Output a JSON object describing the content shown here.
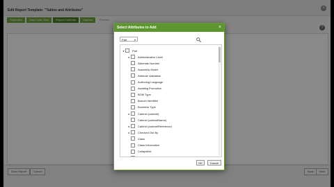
{
  "app": {
    "title": "Edit Report Template: \"Tables and Attributes\"",
    "steps": [
      "Properties",
      "Data Data View",
      "Report Contents",
      "Options",
      "Preview"
    ],
    "footer": {
      "save_report": "Save Report",
      "cancel": "Cancel",
      "back": "Back",
      "next": "Next"
    }
  },
  "modal": {
    "title": "Select Attributes to Add",
    "close": "×",
    "filter_value": "Part",
    "ok": "OK",
    "cancel": "Cancel",
    "tree": [
      {
        "label": "Part",
        "toggle": "▾"
      },
      {
        "label": "Administrative Level",
        "toggle": "▸"
      },
      {
        "label": "Alternate Number",
        "toggle": ""
      },
      {
        "label": "Assembly Model",
        "toggle": ""
      },
      {
        "label": "Attribute Validation",
        "toggle": ""
      },
      {
        "label": "Authoring Language",
        "toggle": ""
      },
      {
        "label": "Awaiting Promotion",
        "toggle": ""
      },
      {
        "label": "BOM Type",
        "toggle": ""
      },
      {
        "label": "Branch Identifier",
        "toggle": ""
      },
      {
        "label": "Business Type",
        "toggle": ""
      },
      {
        "label": "Cabinet (cabinet)",
        "toggle": "▸"
      },
      {
        "label": "Cabinet (cabinetName)",
        "toggle": ""
      },
      {
        "label": "Cabinet (cabinetReference)",
        "toggle": "▸"
      },
      {
        "label": "Checked Out By",
        "toggle": "▸"
      },
      {
        "label": "Class",
        "toggle": ""
      },
      {
        "label": "Class Information",
        "toggle": ""
      },
      {
        "label": "Collapsible",
        "toggle": ""
      },
      {
        "label": "Contextual Class Name",
        "toggle": ""
      }
    ]
  }
}
